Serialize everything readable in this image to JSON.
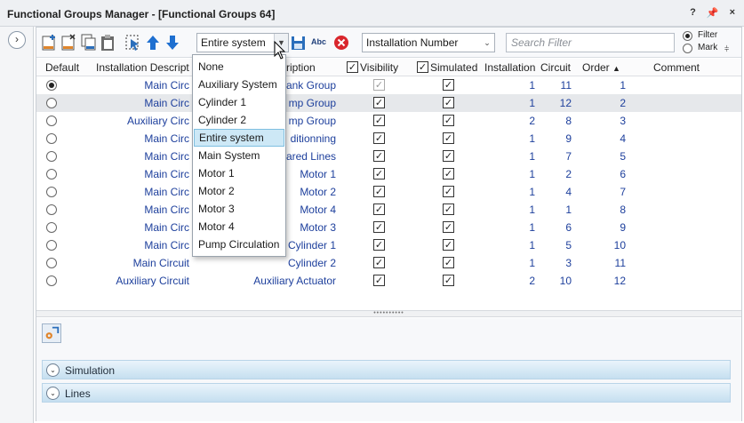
{
  "window": {
    "title": "Functional Groups Manager - [Functional Groups 64]",
    "help": "?",
    "pin": "←",
    "close": "×"
  },
  "toolbar": {
    "scope_selected": "Entire system",
    "sort_selected": "Installation Number",
    "search_placeholder": "Search Filter",
    "filter_label": "Filter",
    "mark_label": "Mark",
    "abc_label": "Abc"
  },
  "dropdown": {
    "options": [
      "None",
      "Auxiliary System",
      "Cylinder  1",
      "Cylinder  2",
      "Entire system",
      "Main System",
      "Motor 1",
      "Motor 2",
      "Motor 3",
      "Motor 4",
      "Pump Circulation"
    ],
    "active": "Entire system"
  },
  "columns": {
    "default": "Default",
    "installation": "Installation Descript",
    "description": "ription",
    "visibility": "Visibility",
    "simulated": "Simulated",
    "installation_no": "Installation",
    "circuit": "Circuit",
    "order": "Order",
    "comment": "Comment"
  },
  "rows": [
    {
      "install": "Main Circ",
      "desc": "ank Group",
      "inst": "1",
      "circuit": "11",
      "order": "1"
    },
    {
      "install": "Main Circ",
      "desc": "mp Group",
      "inst": "1",
      "circuit": "12",
      "order": "2"
    },
    {
      "install": "Auxiliary Circ",
      "desc": "mp Group",
      "inst": "2",
      "circuit": "8",
      "order": "3"
    },
    {
      "install": "Main Circ",
      "desc": "ditionning",
      "inst": "1",
      "circuit": "9",
      "order": "4"
    },
    {
      "install": "Main Circ",
      "desc": "ared Lines",
      "inst": "1",
      "circuit": "7",
      "order": "5"
    },
    {
      "install": "Main Circ",
      "desc": "Motor 1",
      "inst": "1",
      "circuit": "2",
      "order": "6"
    },
    {
      "install": "Main Circ",
      "desc": "Motor 2",
      "inst": "1",
      "circuit": "4",
      "order": "7"
    },
    {
      "install": "Main Circ",
      "desc": "Motor 4",
      "inst": "1",
      "circuit": "1",
      "order": "8"
    },
    {
      "install": "Main Circ",
      "desc": "Motor 3",
      "inst": "1",
      "circuit": "6",
      "order": "9"
    },
    {
      "install": "Main Circ",
      "desc": "Cylinder 1",
      "inst": "1",
      "circuit": "5",
      "order": "10"
    },
    {
      "install": "Main Circuit",
      "desc": "Cylinder 2",
      "inst": "1",
      "circuit": "3",
      "order": "11"
    },
    {
      "install": "Auxiliary Circuit",
      "desc": "Auxiliary Actuator",
      "inst": "2",
      "circuit": "10",
      "order": "12"
    }
  ],
  "panels": {
    "simulation": "Simulation",
    "lines": "Lines"
  },
  "colors": {
    "accent": "#1d3f9c",
    "panel": "#c5dff0",
    "selection": "#cde8f6"
  }
}
